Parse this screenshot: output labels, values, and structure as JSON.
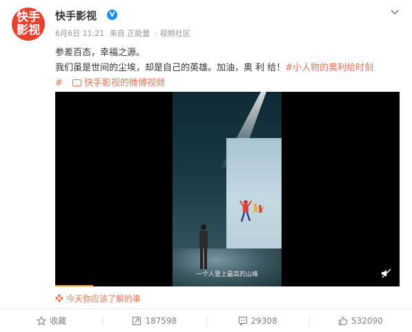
{
  "post": {
    "avatar_text": "快手影视",
    "username": "快手影视",
    "verified_mark": "V",
    "meta": {
      "date": "6月6日 11:21",
      "source": "来自 正能量",
      "community": "· 视频社区"
    },
    "text_line1": "参差百态，幸福之源。",
    "text_line2": "我们虽是世间的尘埃，却是自己的英雄。加油，奥 利 给！",
    "hashtag_part1": "#小人物的奥利给时刻",
    "hashtag_part2": "#",
    "video_link": "快手影视的微博视频",
    "video": {
      "subtitle": "一个人登上最高的山峰",
      "progress_fraction": 0.11
    },
    "recommend": "今天你应该了解的事"
  },
  "actions": {
    "favorite": "收藏",
    "repost_count": "187598",
    "comment_count": "29308",
    "like_count": "532090"
  },
  "colors": {
    "accent": "#eb7350",
    "avatar_bg": "#e8412e",
    "verified": "#1b8ff0",
    "progress": "#f59a22"
  },
  "icons": [
    "chevron-down-icon",
    "video-icon",
    "mute-icon",
    "flower-icon",
    "star-icon",
    "repost-icon",
    "comment-icon",
    "like-icon"
  ]
}
